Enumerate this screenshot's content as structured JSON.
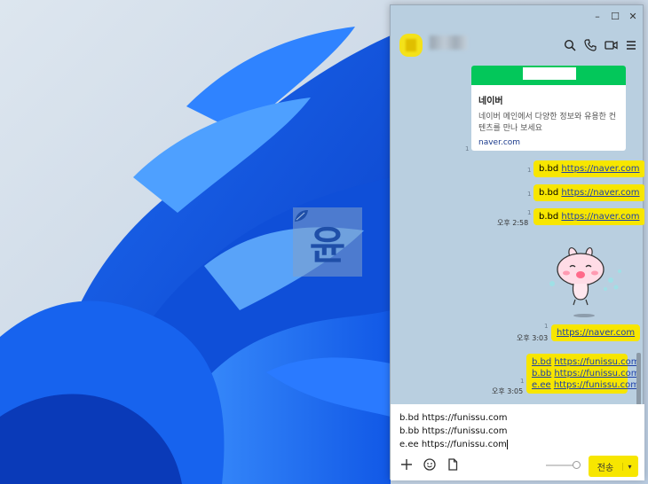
{
  "window": {
    "controls": {
      "minimize": "–",
      "maximize": "☐",
      "close": "✕"
    },
    "header_icons": [
      "search-icon",
      "phone-icon",
      "video-icon",
      "menu-icon"
    ]
  },
  "watermark": {
    "glyph": "윤"
  },
  "link_card": {
    "title": "네이버",
    "description": "네이버 메인에서 다양한 정보와 유용한 컨텐츠를 만나 보세요",
    "url": "naver.com"
  },
  "messages": [
    {
      "prefix": "b.bd",
      "link": "https://naver.com"
    },
    {
      "prefix": "b.bd",
      "link": "https://naver.com"
    },
    {
      "prefix": "b.bd",
      "link": "https://naver.com",
      "time": "오후 2:58"
    },
    {
      "prefix": "",
      "link": "https://naver.com",
      "time": "오후 3:03"
    },
    {
      "lines": [
        {
          "prefix": "b.bd",
          "link": "https://funissu.com"
        },
        {
          "prefix": "b.bb",
          "link": "https://funissu.com"
        },
        {
          "prefix": "e.ee",
          "link": "https://funissu.com"
        }
      ],
      "time": "오후 3:05"
    }
  ],
  "input": {
    "text": "b.bd https://funissu.com\nb.bb https://funissu.com\ne.ee https://funissu.com"
  },
  "toolbar": {
    "icons": [
      "plus-icon",
      "emoji-icon",
      "file-icon"
    ],
    "send_label": "전송",
    "dropdown": "▾"
  },
  "colors": {
    "chat_bg": "#b9cfe0",
    "bubble": "#f7e600",
    "link": "#1d3fa8",
    "naver_green": "#03c75a"
  }
}
